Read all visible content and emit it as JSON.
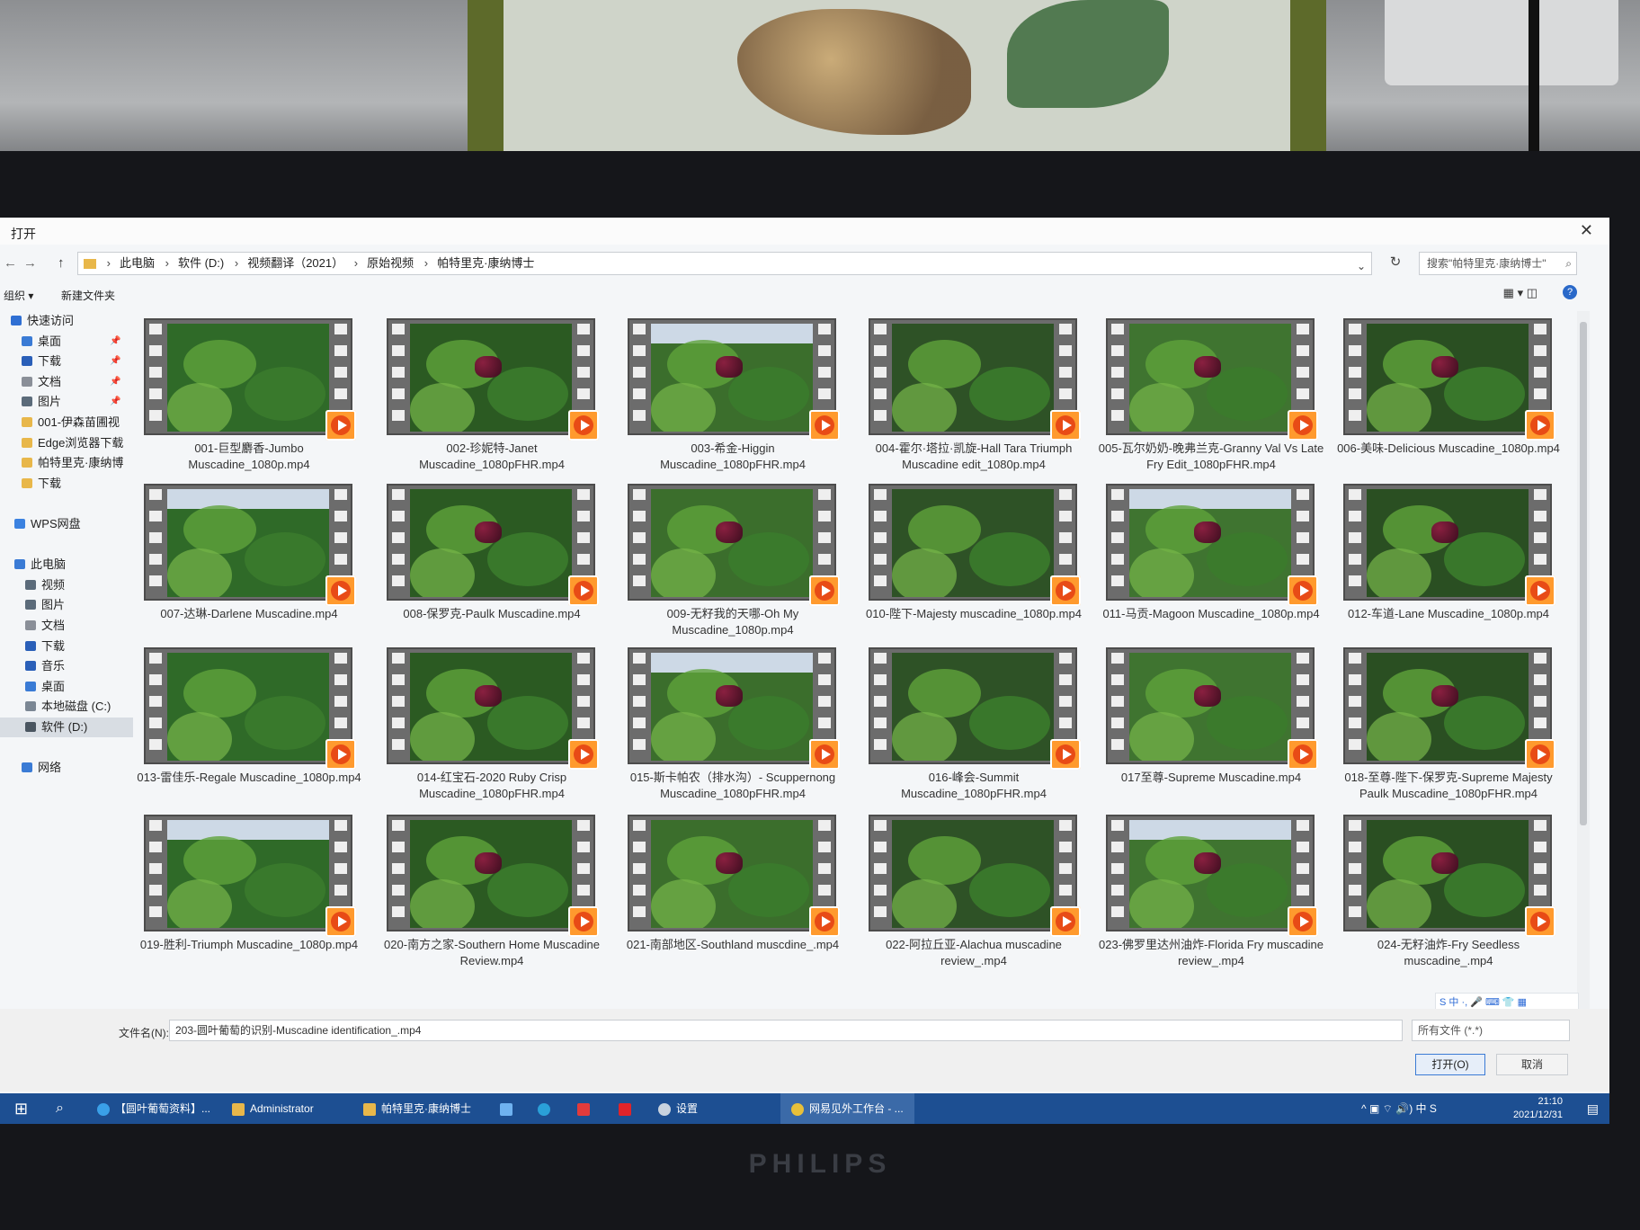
{
  "window": {
    "title": "打开",
    "close": "✕"
  },
  "address": {
    "back": "←",
    "forward": "→",
    "up": "↑",
    "crumbs": [
      "此电脑",
      "软件 (D:)",
      "视频翻译（2021）",
      "原始视频",
      "帕特里克·康纳博士"
    ],
    "refresh": "↻",
    "search_placeholder": "搜索\"帕特里克·康纳博士\""
  },
  "toolbar": {
    "organize": "组织 ▾",
    "new_folder": "新建文件夹",
    "view": "▦ ▾   ◫",
    "help": "?"
  },
  "sidebar": [
    {
      "label": "快速访问",
      "icon": "star-icon",
      "color": "#2f6fd3",
      "indent": 12,
      "pin": ""
    },
    {
      "label": "桌面",
      "icon": "desktop-icon",
      "color": "#3a7bd5",
      "indent": 24,
      "pin": "📌"
    },
    {
      "label": "下载",
      "icon": "download-icon",
      "color": "#2a5fb8",
      "indent": 24,
      "pin": "📌"
    },
    {
      "label": "文档",
      "icon": "document-icon",
      "color": "#8a8f98",
      "indent": 24,
      "pin": "📌"
    },
    {
      "label": "图片",
      "icon": "picture-icon",
      "color": "#5b6b7a",
      "indent": 24,
      "pin": "📌"
    },
    {
      "label": "001-伊森苗圃视",
      "icon": "folder-icon",
      "color": "#e8b74a",
      "indent": 24,
      "pin": ""
    },
    {
      "label": "Edge浏览器下载",
      "icon": "folder-icon",
      "color": "#e8b74a",
      "indent": 24,
      "pin": ""
    },
    {
      "label": "帕特里克·康纳博",
      "icon": "folder-icon",
      "color": "#e8b74a",
      "indent": 24,
      "pin": ""
    },
    {
      "label": "下载",
      "icon": "folder-icon",
      "color": "#e8b74a",
      "indent": 24,
      "pin": ""
    },
    {
      "label": "",
      "icon": "",
      "color": "",
      "indent": 0,
      "pin": ""
    },
    {
      "label": "WPS网盘",
      "icon": "cloud-icon",
      "color": "#3b82e0",
      "indent": 16,
      "pin": ""
    },
    {
      "label": "",
      "icon": "",
      "color": "",
      "indent": 0,
      "pin": ""
    },
    {
      "label": "此电脑",
      "icon": "computer-icon",
      "color": "#3a7bd5",
      "indent": 16,
      "pin": ""
    },
    {
      "label": "视频",
      "icon": "video-icon",
      "color": "#5b6b7a",
      "indent": 28,
      "pin": ""
    },
    {
      "label": "图片",
      "icon": "picture-icon",
      "color": "#5b6b7a",
      "indent": 28,
      "pin": ""
    },
    {
      "label": "文档",
      "icon": "document-icon",
      "color": "#8a8f98",
      "indent": 28,
      "pin": ""
    },
    {
      "label": "下载",
      "icon": "download-icon",
      "color": "#2a5fb8",
      "indent": 28,
      "pin": ""
    },
    {
      "label": "音乐",
      "icon": "music-icon",
      "color": "#2a5fb8",
      "indent": 28,
      "pin": ""
    },
    {
      "label": "桌面",
      "icon": "desktop-icon",
      "color": "#3a7bd5",
      "indent": 28,
      "pin": ""
    },
    {
      "label": "本地磁盘 (C:)",
      "icon": "drive-icon",
      "color": "#7b8794",
      "indent": 28,
      "pin": ""
    },
    {
      "label": "软件 (D:)",
      "icon": "drive-icon",
      "color": "#4a5560",
      "indent": 28,
      "pin": "",
      "selected": true
    },
    {
      "label": "",
      "icon": "",
      "color": "",
      "indent": 0,
      "pin": ""
    },
    {
      "label": "网络",
      "icon": "network-icon",
      "color": "#3a7bd5",
      "indent": 24,
      "pin": ""
    }
  ],
  "files": [
    "001-巨型麝香-Jumbo Muscadine_1080p.mp4",
    "002-珍妮特-Janet Muscadine_1080pFHR.mp4",
    "003-希金-Higgin Muscadine_1080pFHR.mp4",
    "004-霍尔·塔拉·凯旋-Hall Tara Triumph Muscadine edit_1080p.mp4",
    "005-瓦尔奶奶-晚弗兰克-Granny Val Vs Late Fry Edit_1080pFHR.mp4",
    "006-美味-Delicious Muscadine_1080p.mp4",
    "007-达琳-Darlene Muscadine.mp4",
    "008-保罗克-Paulk Muscadine.mp4",
    "009-无籽我的天哪-Oh My Muscadine_1080p.mp4",
    "010-陛下-Majesty muscadine_1080p.mp4",
    "011-马贡-Magoon Muscadine_1080p.mp4",
    "012-车道-Lane Muscadine_1080p.mp4",
    "013-雷佳乐-Regale Muscadine_1080p.mp4",
    "014-红宝石-2020 Ruby Crisp Muscadine_1080pFHR.mp4",
    "015-斯卡帕农（排水沟）- Scuppernong Muscadine_1080pFHR.mp4",
    "016-峰会-Summit Muscadine_1080pFHR.mp4",
    "017至尊-Supreme Muscadine.mp4",
    "018-至尊-陛下-保罗克-Supreme Majesty Paulk Muscadine_1080pFHR.mp4",
    "019-胜利-Triumph Muscadine_1080p.mp4",
    "020-南方之家-Southern Home Muscadine Review.mp4",
    "021-南部地区-Southland muscdine_.mp4",
    "022-阿拉丘亚-Alachua muscadine review_.mp4",
    "023-佛罗里达州油炸-Florida Fry muscadine review_.mp4",
    "024-无籽油炸-Fry Seedless muscadine_.mp4"
  ],
  "bottom": {
    "filename_label": "文件名(N):",
    "filename_value": "203-圆叶葡萄的识别-Muscadine identification_.mp4",
    "filetype": "所有文件 (*.*)",
    "open_button": "打开(O)",
    "cancel_button": "取消"
  },
  "ime": "S 中 ·, 🎤 ⌨ 👕 ▦",
  "taskbar": {
    "items": [
      "【圆叶葡萄资料】...",
      "Administrator",
      "帕特里克·康纳博士",
      "设置",
      "网易见外工作台 - ..."
    ],
    "tray_icons": "^ ▣ ⌔ 🔊) 中 S",
    "time": "21:10",
    "date": "2021/12/31"
  },
  "monitor_brand": "PHILIPS"
}
